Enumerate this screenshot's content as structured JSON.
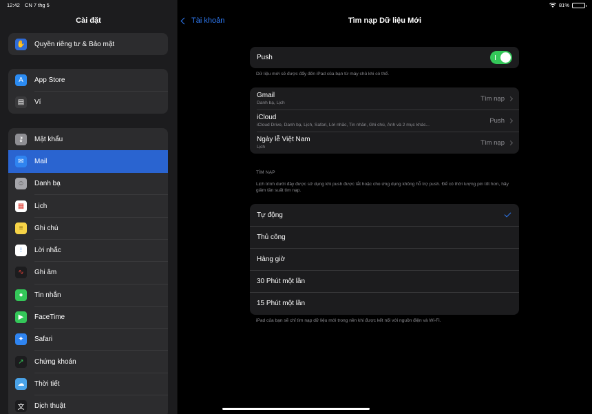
{
  "status": {
    "time": "12:42",
    "date": "CN 7 thg 5",
    "battery": "81%",
    "battery_level": 0.81
  },
  "sidebar": {
    "title": "Cài đặt",
    "group1": [
      {
        "label": "Quyền riêng tư & Bảo mật",
        "icon": "hand-icon",
        "color": "#2f6bd7"
      }
    ],
    "group2": [
      {
        "label": "App Store",
        "icon": "app-store-icon",
        "color": "#2b8bf2"
      },
      {
        "label": "Ví",
        "icon": "wallet-icon",
        "color": "#3a3a3c"
      }
    ],
    "group3": [
      {
        "label": "Mật khẩu",
        "icon": "key-icon",
        "color": "#8e8e93"
      },
      {
        "label": "Mail",
        "icon": "mail-icon",
        "color": "#2f84f0",
        "active": true
      },
      {
        "label": "Danh bạ",
        "icon": "contacts-icon",
        "color": "#a5a5aa"
      },
      {
        "label": "Lịch",
        "icon": "calendar-icon",
        "color": "#ffffff"
      },
      {
        "label": "Ghi chú",
        "icon": "notes-icon",
        "color": "#f6d347"
      },
      {
        "label": "Lời nhắc",
        "icon": "reminders-icon",
        "color": "#ffffff"
      },
      {
        "label": "Ghi âm",
        "icon": "voice-memos-icon",
        "color": "#1c1c1e"
      },
      {
        "label": "Tin nhắn",
        "icon": "messages-icon",
        "color": "#34c759"
      },
      {
        "label": "FaceTime",
        "icon": "facetime-icon",
        "color": "#34c759"
      },
      {
        "label": "Safari",
        "icon": "safari-icon",
        "color": "#2f84f0"
      },
      {
        "label": "Chứng khoán",
        "icon": "stocks-icon",
        "color": "#1c1c1e"
      },
      {
        "label": "Thời tiết",
        "icon": "weather-icon",
        "color": "#4aa3e8"
      },
      {
        "label": "Dịch thuật",
        "icon": "translate-icon",
        "color": "#1c1c1e"
      }
    ]
  },
  "nav": {
    "back_label": "Tài khoản",
    "title": "Tìm nạp Dữ liệu Mới"
  },
  "push": {
    "label": "Push",
    "enabled": true,
    "note": "Dữ liệu mới sẽ được đẩy đến iPad của bạn từ máy chủ khi có thể."
  },
  "accounts": [
    {
      "name": "Gmail",
      "detail": "Danh bạ, Lịch",
      "value": "Tìm nạp"
    },
    {
      "name": "iCloud",
      "detail": "iCloud Drive, Danh bạ, Lịch, Safari, Lời nhắc, Tin nhắn, Ghi chú, Ảnh và 2 mục khác...",
      "value": "Push"
    },
    {
      "name": "Ngày lễ Việt Nam",
      "detail": "Lịch",
      "value": "Tìm nạp"
    }
  ],
  "fetch": {
    "header": "TÌM NẠP",
    "description": "Lịch trình dưới đây được sử dụng khi push được tắt hoặc cho ứng dụng không hỗ trợ push. Để có thời lượng pin tốt hơn, hãy giảm tần suất tìm nạp.",
    "options": [
      {
        "label": "Tự động",
        "selected": true
      },
      {
        "label": "Thủ công",
        "selected": false
      },
      {
        "label": "Hàng giờ",
        "selected": false
      },
      {
        "label": "30 Phút một lần",
        "selected": false
      },
      {
        "label": "15 Phút một lần",
        "selected": false
      }
    ],
    "footer": "iPad của bạn sẽ chỉ tìm nạp dữ liệu mới trong nền khi được kết nối với nguồn điện và Wi-Fi."
  }
}
